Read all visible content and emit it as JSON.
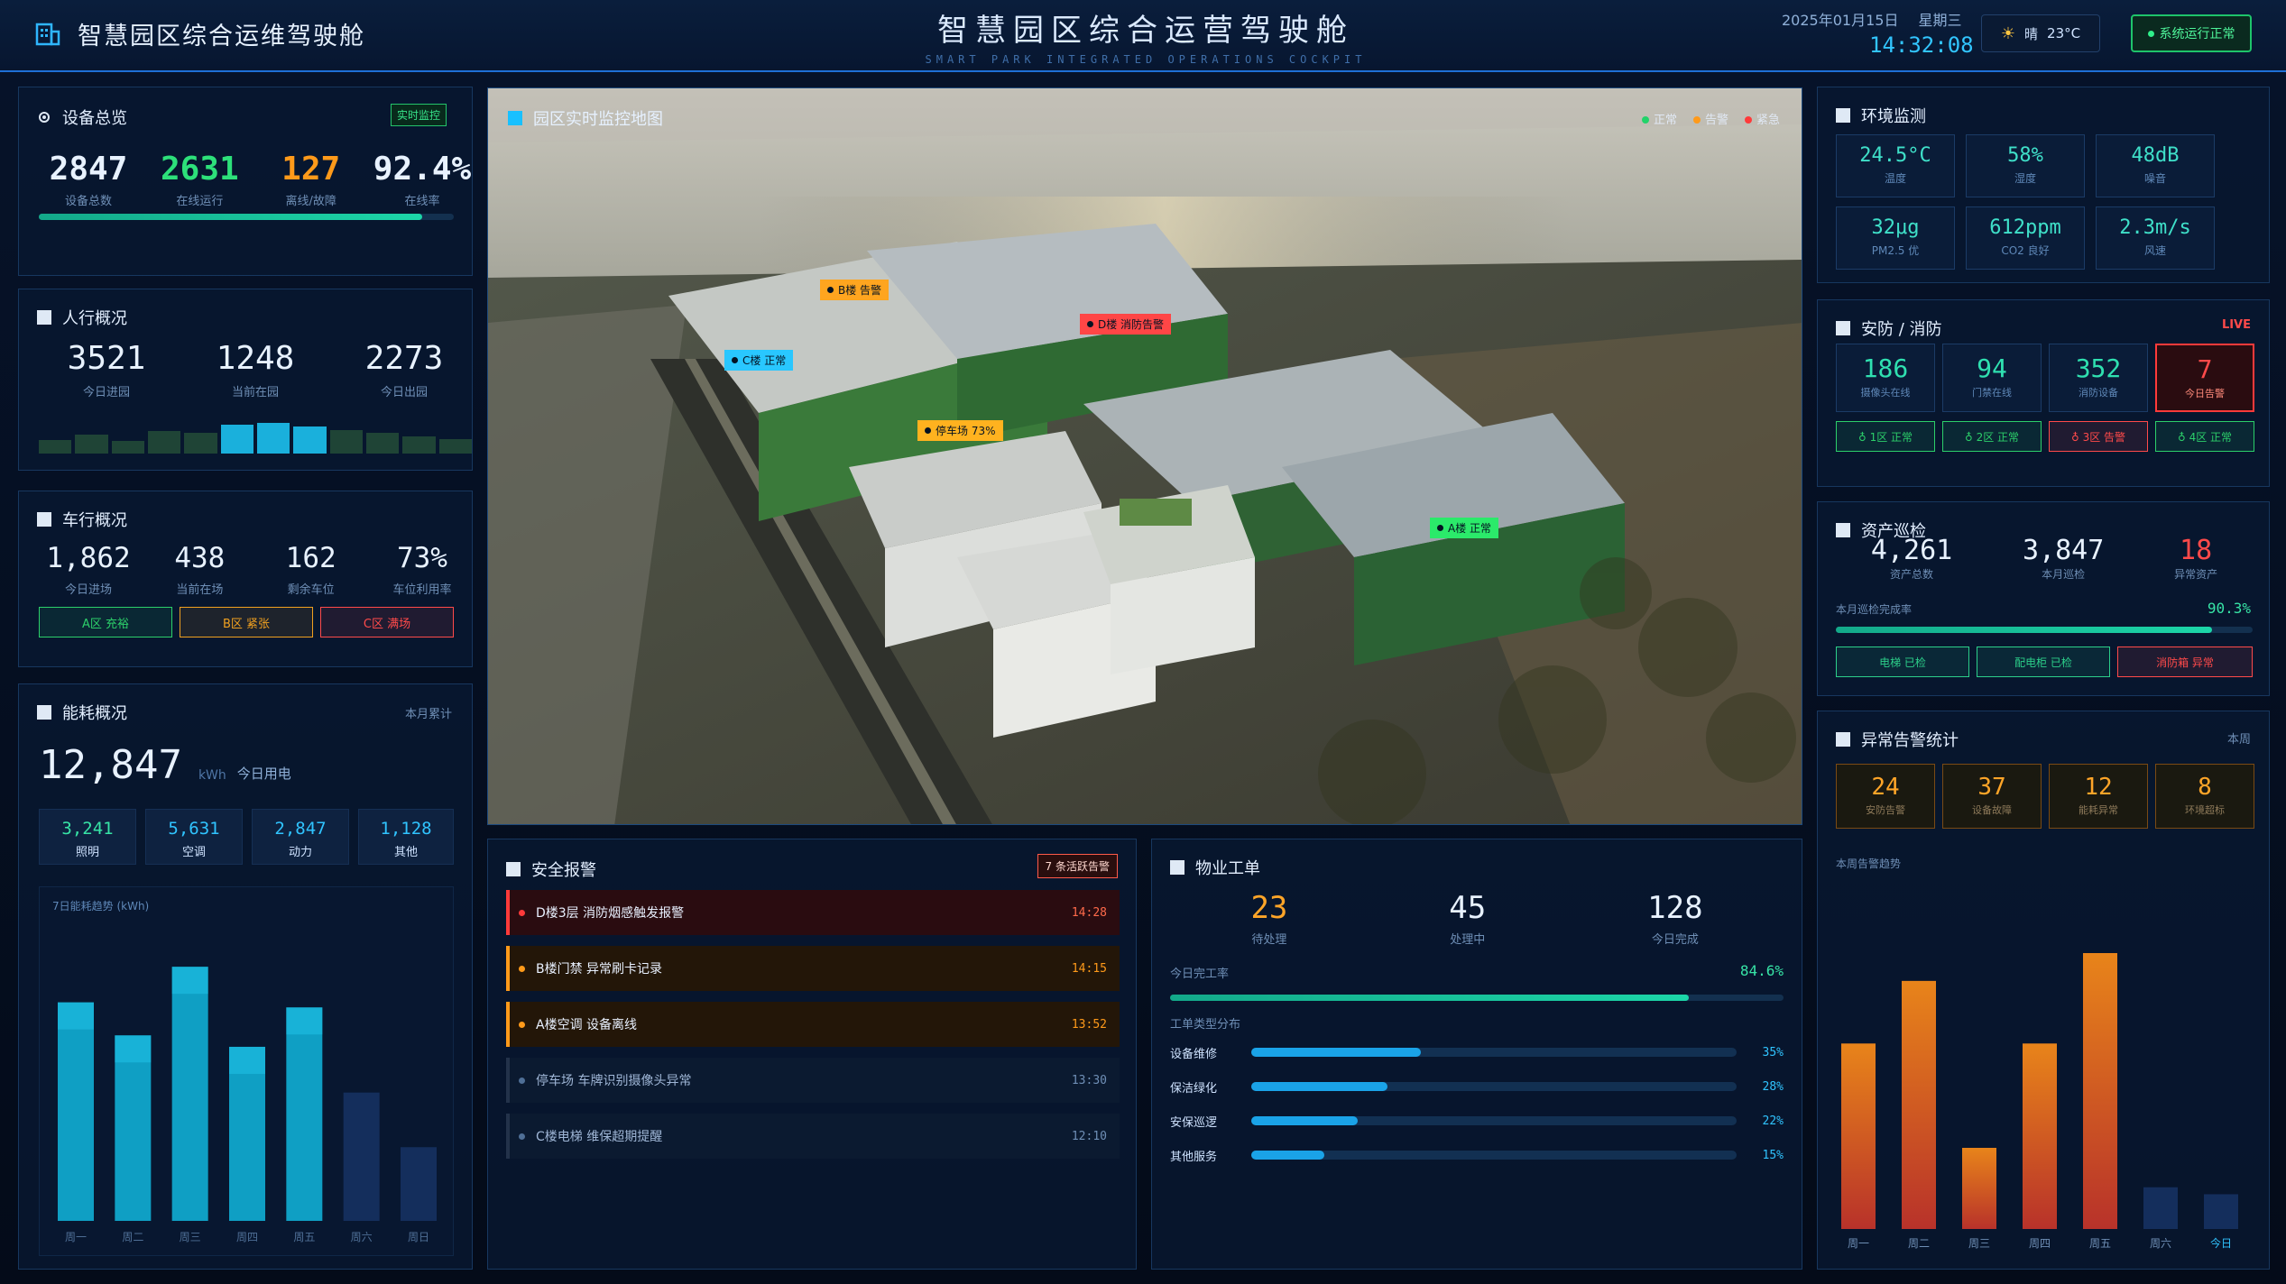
{
  "header": {
    "left_title": "智慧园区综合运维驾驶舱",
    "center_title": "智慧园区综合运营驾驶舱",
    "center_subtitle": "SMART PARK INTEGRATED OPERATIONS COCKPIT",
    "date": "2025年01月15日",
    "weekday": "星期三",
    "time": "14:32:08",
    "weather_icon": "sun-icon",
    "weather_text": "晴",
    "temperature": "23°C",
    "system_status": "系统运行正常"
  },
  "device": {
    "title": "设备总览",
    "badge": "实时监控",
    "total": "2847",
    "total_label": "设备总数",
    "online": "2631",
    "online_label": "在线运行",
    "offline": "127",
    "offline_label": "离线/故障",
    "rate": "92.4%",
    "rate_label": "在线率",
    "rate_fraction": 0.924
  },
  "people": {
    "title": "人行概况",
    "in": "3521",
    "in_label": "今日进园",
    "current": "1248",
    "current_label": "当前在园",
    "out": "2273",
    "out_label": "今日出园",
    "trend": [
      0.28,
      0.4,
      0.26,
      0.48,
      0.44,
      0.62,
      0.66,
      0.58,
      0.5,
      0.44,
      0.36,
      0.3
    ]
  },
  "vehicle": {
    "title": "车行概况",
    "in": "1,862",
    "in_label": "今日进场",
    "current": "438",
    "current_label": "当前在场",
    "free": "162",
    "free_label": "剩余车位",
    "util": "73%",
    "util_label": "车位利用率",
    "zones": [
      {
        "label": "A区 充裕",
        "color": "#2ccf6a"
      },
      {
        "label": "B区 紧张",
        "color": "#f0a020"
      },
      {
        "label": "C区 满场",
        "color": "#ff4a4a"
      }
    ]
  },
  "energy": {
    "title": "能耗概况",
    "period": "本月累计",
    "total": "12,847",
    "unit": "kWh",
    "total_label": "今日用电",
    "items": [
      {
        "value": "3,241",
        "label": "照明",
        "color": "#37e4a6"
      },
      {
        "value": "5,631",
        "label": "空调",
        "color": "#30c4ff"
      },
      {
        "value": "2,847",
        "label": "动力",
        "color": "#30c4ff"
      },
      {
        "value": "1,128",
        "label": "其他",
        "color": "#30c4ff"
      }
    ],
    "chart_title": "7日能耗趋势 (kWh)"
  },
  "chart_data": [
    {
      "type": "bar",
      "title": "7日能耗趋势 (kWh)",
      "categories": [
        "周一",
        "周二",
        "周三",
        "周四",
        "周五",
        "周六",
        "周日"
      ],
      "values": [
        172,
        146,
        200,
        137,
        168,
        101,
        58
      ]
    },
    {
      "type": "bar",
      "title": "本周告警趋势",
      "categories": [
        "周一",
        "周二",
        "周三",
        "周四",
        "周五",
        "周六",
        "今日"
      ],
      "values": [
        80,
        107,
        35,
        80,
        119,
        18,
        15
      ]
    }
  ],
  "map": {
    "title": "园区实时监控地图",
    "legend": [
      {
        "label": "正常",
        "color": "#22d36a"
      },
      {
        "label": "告警",
        "color": "#ff9a1a"
      },
      {
        "label": "紧急",
        "color": "#ff3a3a"
      }
    ],
    "pins": [
      {
        "label": "B楼 告警",
        "color": "#ffa51f"
      },
      {
        "label": "D楼 消防告警",
        "color": "#ff4646"
      },
      {
        "label": "C楼 正常",
        "color": "#29c7ff"
      },
      {
        "label": "停车场 73%",
        "color": "#ffb21f"
      },
      {
        "label": "A楼 正常",
        "color": "#2bea6a"
      }
    ]
  },
  "alarms": {
    "title": "安全报警",
    "badge": "7 条活跃告警",
    "rows": [
      {
        "text": "D楼3层  消防烟感触发报警",
        "time": "14:28",
        "level": "red"
      },
      {
        "text": "B楼门禁  异常刷卡记录",
        "time": "14:15",
        "level": "orange"
      },
      {
        "text": "A楼空调  设备离线",
        "time": "13:52",
        "level": "orange"
      },
      {
        "text": "停车场  车牌识别摄像头异常",
        "time": "13:30",
        "level": "grey"
      },
      {
        "text": "C楼电梯  维保超期提醒",
        "time": "12:10",
        "level": "grey"
      }
    ]
  },
  "workorder": {
    "title": "物业工单",
    "pending": "23",
    "pending_label": "待处理",
    "processing": "45",
    "processing_label": "处理中",
    "done": "128",
    "done_label": "今日完成",
    "rate_label": "今日完工率",
    "rate": "84.6%",
    "rate_fraction": 0.846,
    "type_title": "工单类型分布",
    "types": [
      {
        "name": "设备维修",
        "pct": "35%",
        "fraction": 0.35
      },
      {
        "name": "保洁绿化",
        "pct": "28%",
        "fraction": 0.28
      },
      {
        "name": "安保巡逻",
        "pct": "22%",
        "fraction": 0.22
      },
      {
        "name": "其他服务",
        "pct": "15%",
        "fraction": 0.15
      }
    ]
  },
  "environment": {
    "title": "环境监测",
    "items": [
      {
        "value": "24.5°C",
        "label": "温度"
      },
      {
        "value": "58%",
        "label": "湿度"
      },
      {
        "value": "48dB",
        "label": "噪音"
      },
      {
        "value": "32μg",
        "label": "PM2.5  优"
      },
      {
        "value": "612ppm",
        "label": "CO2  良好"
      },
      {
        "value": "2.3m/s",
        "label": "风速"
      }
    ]
  },
  "security": {
    "title": "安防 / 消防",
    "live": "LIVE",
    "items": [
      {
        "value": "186",
        "label": "摄像头在线"
      },
      {
        "value": "94",
        "label": "门禁在线"
      },
      {
        "value": "352",
        "label": "消防设备"
      },
      {
        "value": "7",
        "label": "今日告警"
      }
    ],
    "zones": [
      {
        "label": "1区 正常",
        "color": "#2ccf6a"
      },
      {
        "label": "2区 正常",
        "color": "#2ccf6a"
      },
      {
        "label": "3区 告警",
        "color": "#ff4a4a"
      },
      {
        "label": "4区 正常",
        "color": "#2ccf6a"
      }
    ]
  },
  "assets": {
    "title": "资产巡检",
    "total": "4,261",
    "total_label": "资产总数",
    "patrol": "3,847",
    "patrol_label": "本月巡检",
    "abnormal": "18",
    "abnormal_label": "异常资产",
    "rate_label": "本月巡检完成率",
    "rate": "90.3%",
    "rate_fraction": 0.903,
    "tags": [
      {
        "label": "电梯 已检",
        "color": "#2ccf8a"
      },
      {
        "label": "配电柜 已检",
        "color": "#2ccf8a"
      },
      {
        "label": "消防箱 异常",
        "color": "#ff4a4a"
      }
    ]
  },
  "anomaly": {
    "title": "异常告警统计",
    "period": "本周",
    "items": [
      {
        "value": "24",
        "label": "安防告警"
      },
      {
        "value": "37",
        "label": "设备故障"
      },
      {
        "value": "12",
        "label": "能耗异常"
      },
      {
        "value": "8",
        "label": "环境超标"
      }
    ],
    "chart_title": "本周告警趋势"
  }
}
